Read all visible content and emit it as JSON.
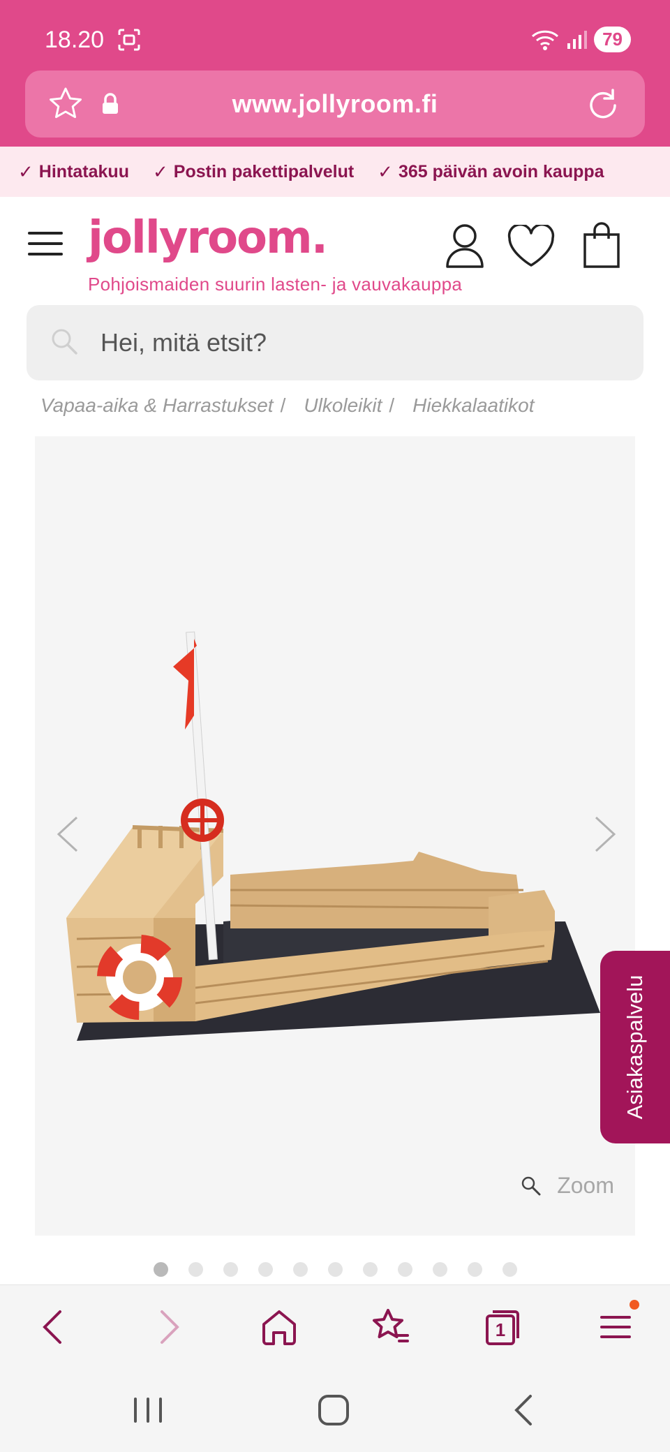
{
  "status_bar": {
    "time": "18.20",
    "battery": "79"
  },
  "browser": {
    "url": "www.jollyroom.fi"
  },
  "usp": [
    {
      "label": "Hintatakuu"
    },
    {
      "label": "Postin pakettipalvelut"
    },
    {
      "label": "365 päivän avoin kauppa"
    }
  ],
  "header": {
    "logo": "jollyroom.",
    "tagline": "Pohjoismaiden suurin lasten- ja vauvakauppa"
  },
  "search": {
    "placeholder": "Hei, mitä etsit?"
  },
  "breadcrumb": [
    {
      "label": "Vapaa-aika & Harrastukset"
    },
    {
      "label": "Ulkoleikit"
    },
    {
      "label": "Hiekkalaatikot"
    }
  ],
  "gallery": {
    "zoom_label": "Zoom",
    "total_images": 11,
    "active_index": 0
  },
  "customer_service": {
    "label": "Asiakaspalvelu"
  },
  "toolbar": {
    "tabs_count": "1"
  },
  "colors": {
    "brand_pink": "#e0498a",
    "dark_magenta": "#a21559",
    "usp_text": "#8b1550"
  }
}
